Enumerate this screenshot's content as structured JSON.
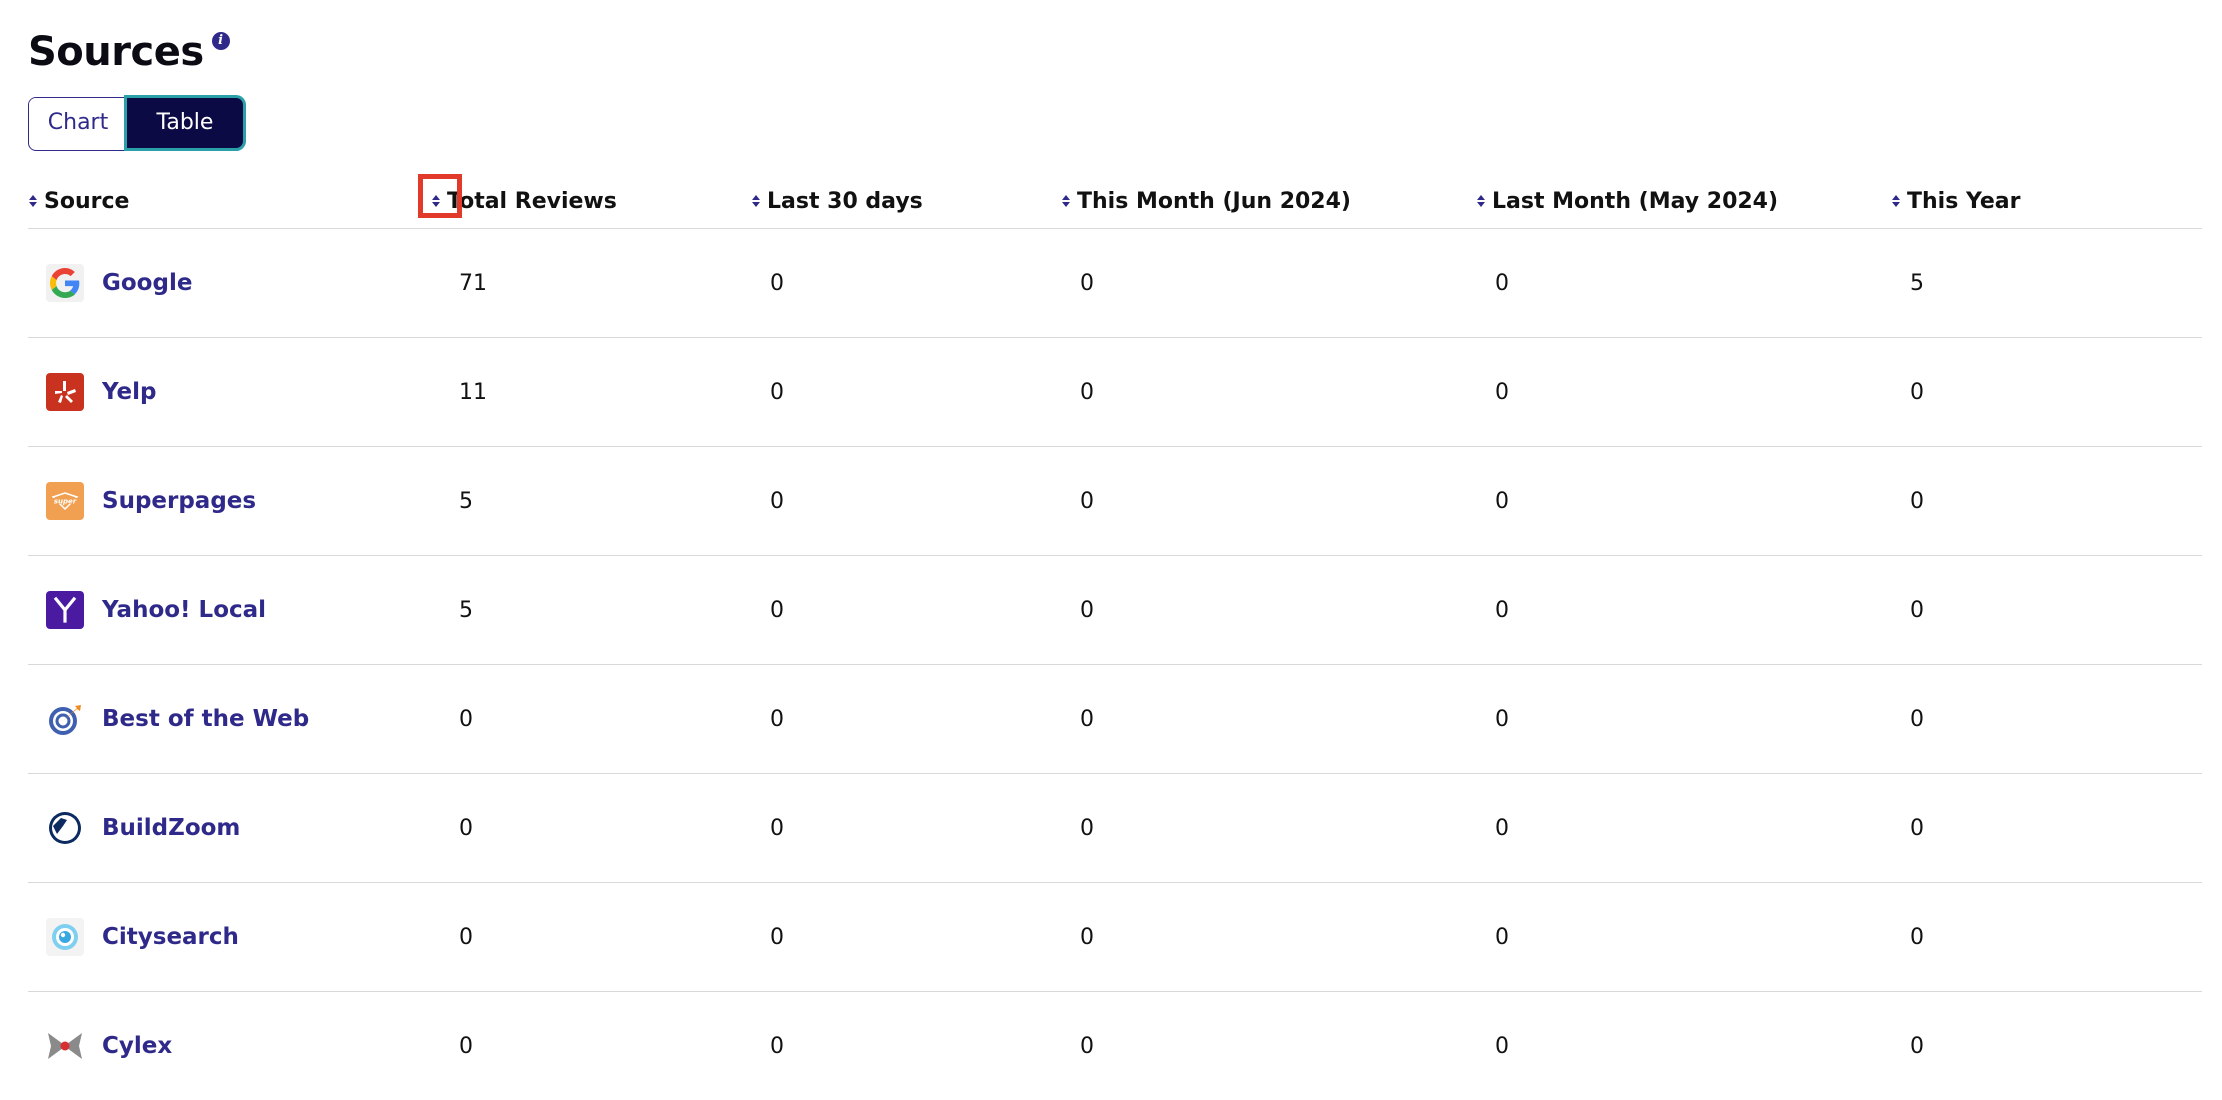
{
  "header": {
    "title": "Sources",
    "info_icon": "info-icon"
  },
  "view_toggle": {
    "chart_label": "Chart",
    "table_label": "Table",
    "selected": "Table"
  },
  "table": {
    "columns": [
      "Source",
      "Total Reviews",
      "Last 30 days",
      "This Month (Jun 2024)",
      "Last Month (May 2024)",
      "This Year"
    ],
    "rows": [
      {
        "source": "Google",
        "icon": "google-logo-icon",
        "total": "71",
        "last30": "0",
        "this_month": "0",
        "last_month": "0",
        "this_year": "5"
      },
      {
        "source": "Yelp",
        "icon": "yelp-logo-icon",
        "total": "11",
        "last30": "0",
        "this_month": "0",
        "last_month": "0",
        "this_year": "0"
      },
      {
        "source": "Superpages",
        "icon": "superpages-logo-icon",
        "total": "5",
        "last30": "0",
        "this_month": "0",
        "last_month": "0",
        "this_year": "0"
      },
      {
        "source": "Yahoo! Local",
        "icon": "yahoo-logo-icon",
        "total": "5",
        "last30": "0",
        "this_month": "0",
        "last_month": "0",
        "this_year": "0"
      },
      {
        "source": "Best of the Web",
        "icon": "best-of-the-web-logo-icon",
        "total": "0",
        "last30": "0",
        "this_month": "0",
        "last_month": "0",
        "this_year": "0"
      },
      {
        "source": "BuildZoom",
        "icon": "buildzoom-logo-icon",
        "total": "0",
        "last30": "0",
        "this_month": "0",
        "last_month": "0",
        "this_year": "0"
      },
      {
        "source": "Citysearch",
        "icon": "citysearch-logo-icon",
        "total": "0",
        "last30": "0",
        "this_month": "0",
        "last_month": "0",
        "this_year": "0"
      },
      {
        "source": "Cylex",
        "icon": "cylex-logo-icon",
        "total": "0",
        "last30": "0",
        "this_month": "0",
        "last_month": "0",
        "this_year": "0"
      }
    ]
  },
  "colors": {
    "accent": "#2f2a8a",
    "toggle_active_bg": "#0c0a45",
    "toggle_focus_ring": "#2aa0a8",
    "highlight_box": "#e23a2a",
    "divider": "#d9d9d9"
  }
}
